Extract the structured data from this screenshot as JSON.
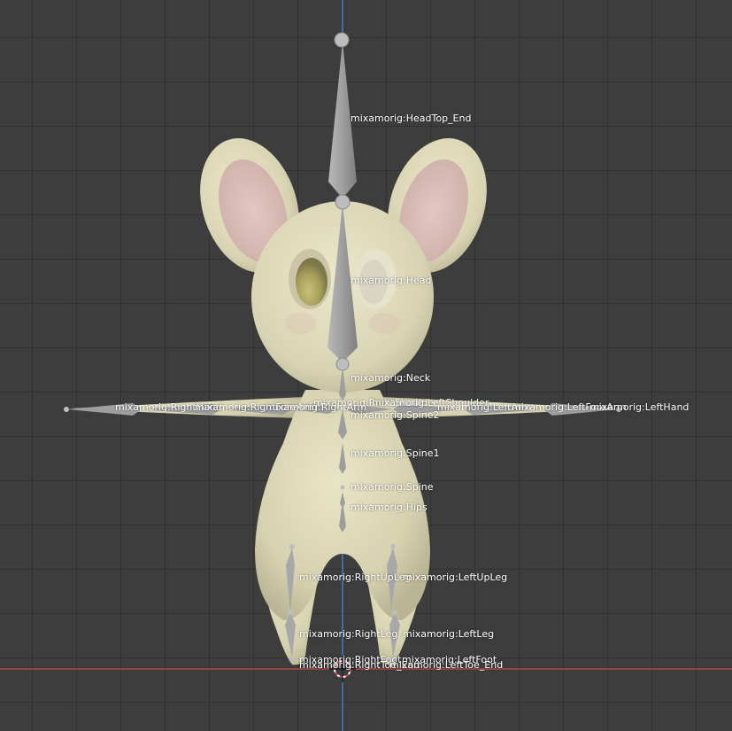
{
  "viewport": {
    "axis_colors": {
      "x": "#d04545",
      "z": "#4a7fd0"
    },
    "grid_color": "#2f2f2f",
    "background": "#3d3d3d"
  },
  "model": {
    "name": "",
    "body_color": "#ddd9b8",
    "ear_inner_color": "#d7b8b2",
    "eye_color": "#b8b06a"
  },
  "armature": {
    "bones": [
      {
        "id": "headtop",
        "label": "mixamorig:HeadTop_End"
      },
      {
        "id": "head",
        "label": "mixamorig:Head"
      },
      {
        "id": "neck",
        "label": "mixamorig:Neck"
      },
      {
        "id": "rightshoulder",
        "label": "mixamorig:RightShoulder"
      },
      {
        "id": "leftshoulder",
        "label": "mixamorig:LeftShoulder"
      },
      {
        "id": "righthand",
        "label": "mixamorig:RightHand"
      },
      {
        "id": "rightforearm",
        "label": "mixamorig:RightForeArm"
      },
      {
        "id": "rightarm",
        "label": "mixamorig:RightArm"
      },
      {
        "id": "spine2",
        "label": "mixamorig:Spine2"
      },
      {
        "id": "leftarm",
        "label": "mixamorig:LeftArm"
      },
      {
        "id": "leftforearm",
        "label": "mixamorig:LeftForeArm"
      },
      {
        "id": "lefthand",
        "label": "mixamorig:LeftHand"
      },
      {
        "id": "spine1",
        "label": "mixamorig:Spine1"
      },
      {
        "id": "spine",
        "label": "mixamorig:Spine"
      },
      {
        "id": "hips",
        "label": "mixamorig:Hips"
      },
      {
        "id": "rightupleg",
        "label": "mixamorig:RightUpLeg"
      },
      {
        "id": "leftupleg",
        "label": "mixamorig:LeftUpLeg"
      },
      {
        "id": "rightleg",
        "label": "mixamorig:RightLeg"
      },
      {
        "id": "leftleg",
        "label": "mixamorig:LeftLeg"
      },
      {
        "id": "rightfoot",
        "label": "mixamorig:RightFoot"
      },
      {
        "id": "leftfoot",
        "label": "mixamorig:LeftFoot"
      },
      {
        "id": "righttoe",
        "label": "mixamorig:RightToe_End"
      },
      {
        "id": "lefttoe",
        "label": "mixamorig:LeftToe_End"
      }
    ]
  }
}
